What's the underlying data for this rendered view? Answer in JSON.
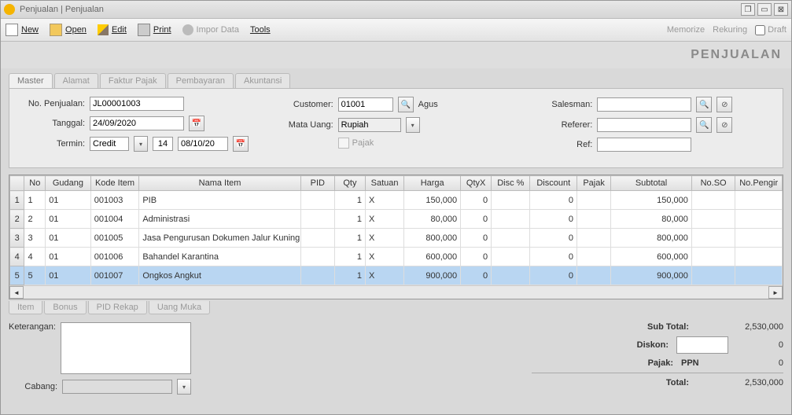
{
  "window": {
    "title": "Penjualan | Penjualan"
  },
  "toolbar": {
    "new": "New",
    "open": "Open",
    "edit": "Edit",
    "print": "Print",
    "import": "Impor Data",
    "tools": "Tools",
    "memorize": "Memorize",
    "rekuring": "Rekuring",
    "draft": "Draft"
  },
  "banner": "PENJUALAN",
  "tabs": {
    "master": "Master",
    "alamat": "Alamat",
    "faktur": "Faktur Pajak",
    "pembayaran": "Pembayaran",
    "akuntansi": "Akuntansi"
  },
  "form": {
    "no_penjualan_label": "No. Penjualan:",
    "no_penjualan": "JL00001003",
    "tanggal_label": "Tanggal:",
    "tanggal": "24/09/2020",
    "termin_label": "Termin:",
    "termin": "Credit",
    "termin_days": "14",
    "termin_due": "08/10/20",
    "customer_label": "Customer:",
    "customer_code": "01001",
    "customer_name": "Agus",
    "mata_uang_label": "Mata Uang:",
    "mata_uang": "Rupiah",
    "pajak_label": "Pajak",
    "salesman_label": "Salesman:",
    "salesman": "",
    "referer_label": "Referer:",
    "referer": "",
    "ref_label": "Ref:",
    "ref": ""
  },
  "grid": {
    "headers": {
      "no": "No",
      "gudang": "Gudang",
      "kode": "Kode Item",
      "nama": "Nama Item",
      "pid": "PID",
      "qty": "Qty",
      "satuan": "Satuan",
      "harga": "Harga",
      "qtyx": "QtyX",
      "discp": "Disc %",
      "discount": "Discount",
      "pajak": "Pajak",
      "subtotal": "Subtotal",
      "noso": "No.SO",
      "nopengir": "No.Pengir"
    },
    "rows": [
      {
        "no": "1",
        "gudang": "01",
        "kode": "001003",
        "nama": "PIB",
        "pid": "",
        "qty": "1",
        "satuan": "X",
        "harga": "150,000",
        "qtyx": "0",
        "discp": "",
        "discount": "0",
        "pajak": "",
        "subtotal": "150,000",
        "noso": "",
        "nopengir": ""
      },
      {
        "no": "2",
        "gudang": "01",
        "kode": "001004",
        "nama": "Administrasi",
        "pid": "",
        "qty": "1",
        "satuan": "X",
        "harga": "80,000",
        "qtyx": "0",
        "discp": "",
        "discount": "0",
        "pajak": "",
        "subtotal": "80,000",
        "noso": "",
        "nopengir": ""
      },
      {
        "no": "3",
        "gudang": "01",
        "kode": "001005",
        "nama": "Jasa Pengurusan Dokumen Jalur Kuning",
        "pid": "",
        "qty": "1",
        "satuan": "X",
        "harga": "800,000",
        "qtyx": "0",
        "discp": "",
        "discount": "0",
        "pajak": "",
        "subtotal": "800,000",
        "noso": "",
        "nopengir": ""
      },
      {
        "no": "4",
        "gudang": "01",
        "kode": "001006",
        "nama": "Bahandel Karantina",
        "pid": "",
        "qty": "1",
        "satuan": "X",
        "harga": "600,000",
        "qtyx": "0",
        "discp": "",
        "discount": "0",
        "pajak": "",
        "subtotal": "600,000",
        "noso": "",
        "nopengir": ""
      },
      {
        "no": "5",
        "gudang": "01",
        "kode": "001007",
        "nama": "Ongkos Angkut",
        "pid": "",
        "qty": "1",
        "satuan": "X",
        "harga": "900,000",
        "qtyx": "0",
        "discp": "",
        "discount": "0",
        "pajak": "",
        "subtotal": "900,000",
        "noso": "",
        "nopengir": ""
      }
    ],
    "selected_index": 4
  },
  "bottom_tabs": {
    "item": "Item",
    "bonus": "Bonus",
    "pid": "PID Rekap",
    "uang": "Uang Muka"
  },
  "footer": {
    "keterangan_label": "Keterangan:",
    "keterangan": "",
    "cabang_label": "Cabang:",
    "cabang": "",
    "subtotal_label": "Sub Total:",
    "subtotal": "2,530,000",
    "diskon_label": "Diskon:",
    "diskon_field": "",
    "diskon_val": "0",
    "pajak_label": "Pajak:",
    "pajak_name": "PPN",
    "pajak_val": "0",
    "total_label": "Total:",
    "total": "2,530,000"
  }
}
